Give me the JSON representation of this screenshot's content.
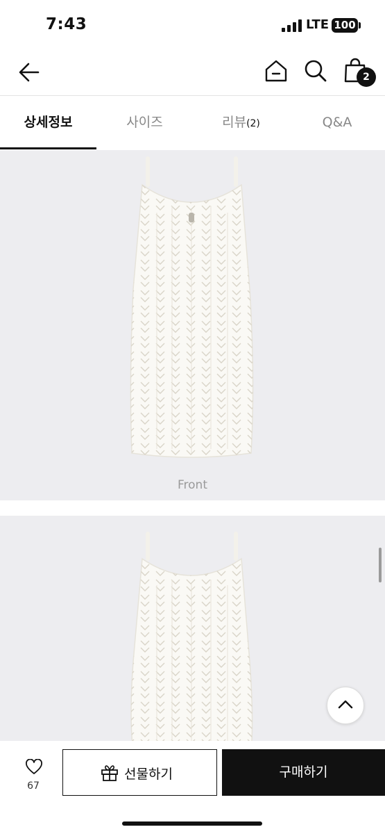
{
  "status_bar": {
    "time": "7:43",
    "network": "LTE",
    "battery": "100"
  },
  "header": {
    "cart_count": "2"
  },
  "tabs": [
    {
      "label": "상세정보",
      "count": ""
    },
    {
      "label": "사이즈",
      "count": ""
    },
    {
      "label": "리뷰",
      "count": "(2)"
    },
    {
      "label": "Q&A",
      "count": ""
    }
  ],
  "gallery": {
    "captions": [
      "Front"
    ]
  },
  "bottom_bar": {
    "like_count": "67",
    "gift_label": "선물하기",
    "buy_label": "구매하기"
  }
}
